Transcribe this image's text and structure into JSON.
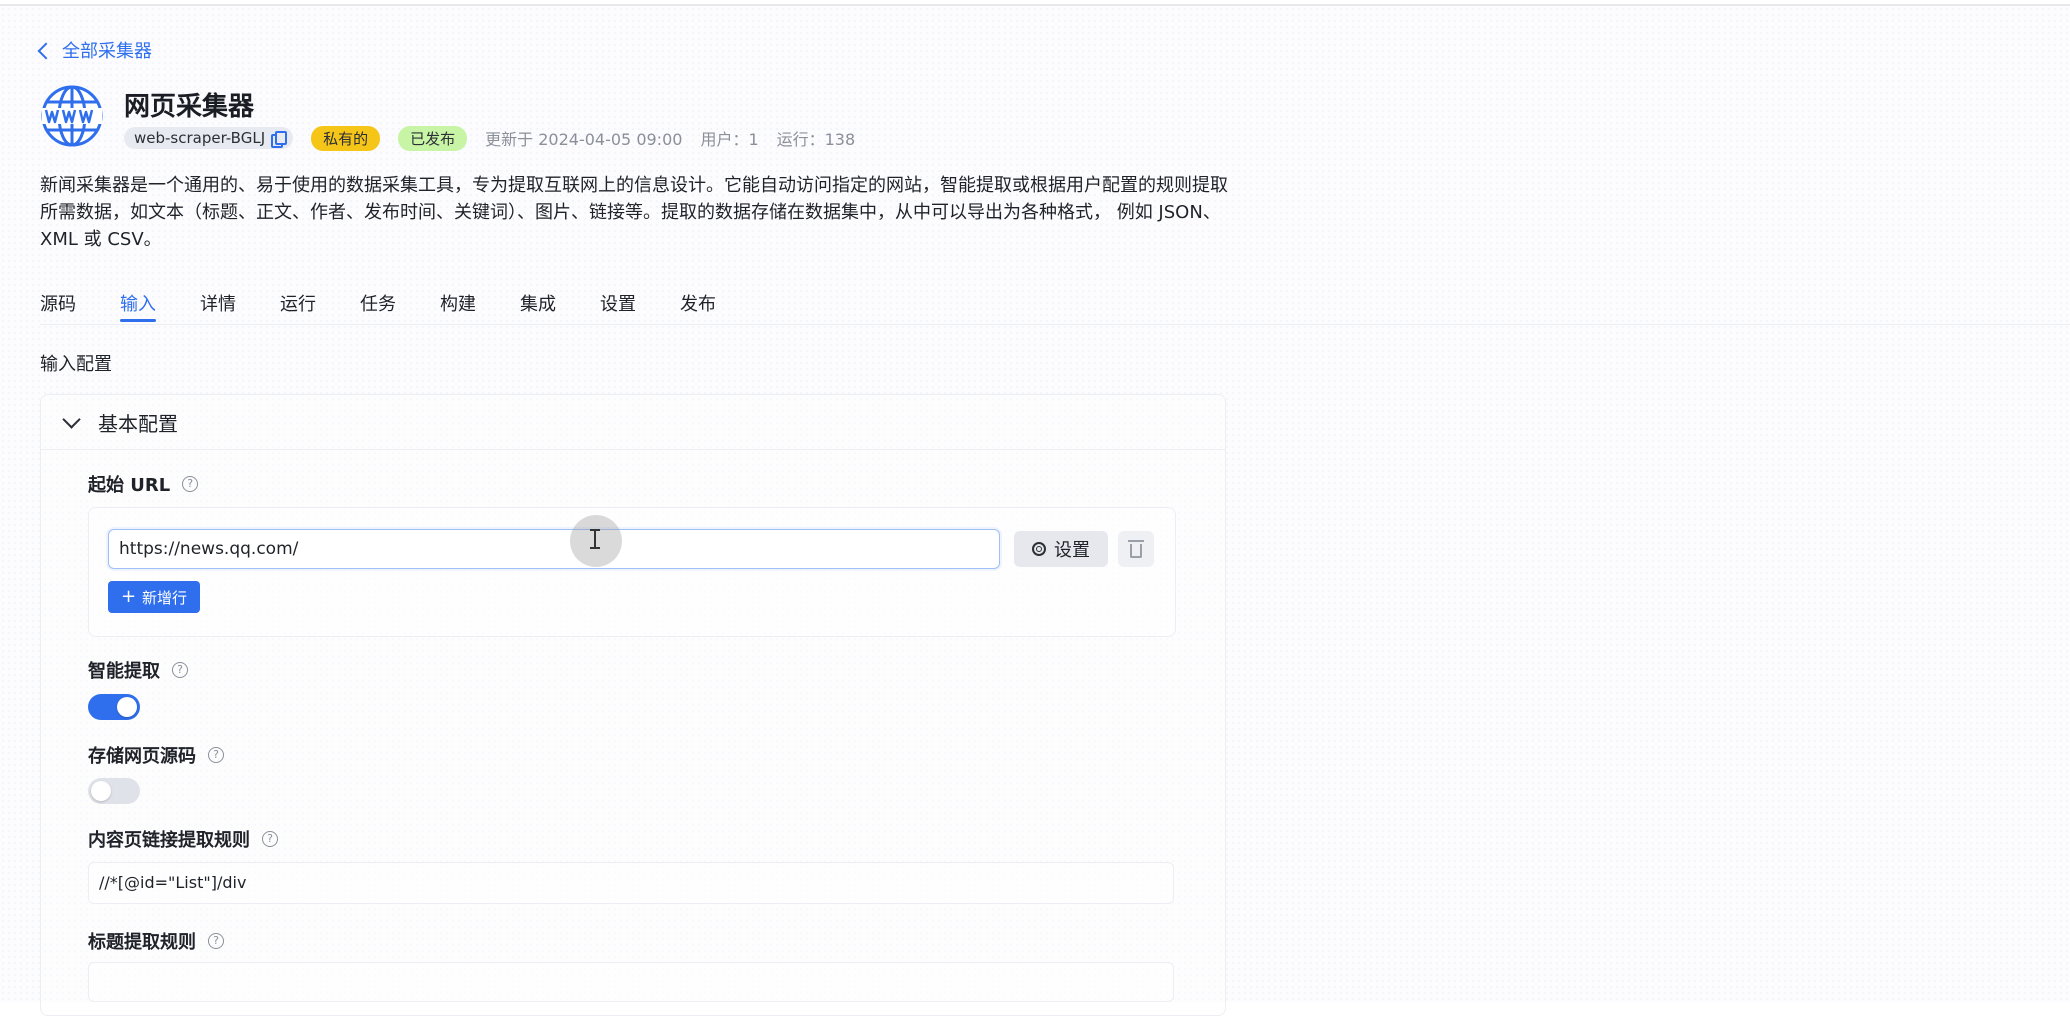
{
  "nav": {
    "back_label": "全部采集器"
  },
  "app": {
    "icon": "globe-www-icon",
    "title": "网页采集器",
    "slug": "web-scraper-BGLJ",
    "badge_private": "私有的",
    "badge_published": "已发布",
    "updated": "更新于 2024-04-05 09:00",
    "users": "用户：1",
    "runs": "运行：138",
    "description": "新闻采集器是一个通用的、易于使用的数据采集工具，专为提取互联网上的信息设计。它能自动访问指定的网站，智能提取或根据用户配置的规则提取所需数据，如文本（标题、正文、作者、发布时间、关键词）、图片、链接等。提取的数据存储在数据集中，从中可以导出为各种格式， 例如 JSON、XML 或 CSV。"
  },
  "tabs": [
    {
      "label": "源码",
      "active": false
    },
    {
      "label": "输入",
      "active": true
    },
    {
      "label": "详情",
      "active": false
    },
    {
      "label": "运行",
      "active": false
    },
    {
      "label": "任务",
      "active": false
    },
    {
      "label": "构建",
      "active": false
    },
    {
      "label": "集成",
      "active": false
    },
    {
      "label": "设置",
      "active": false
    },
    {
      "label": "发布",
      "active": false
    }
  ],
  "input_config": {
    "section_label": "输入配置",
    "panel_title": "基本配置",
    "start_url": {
      "label": "起始 URL",
      "value": "https://news.qq.com/",
      "settings_label": "设置",
      "add_row_label": "新增行"
    },
    "smart_extract": {
      "label": "智能提取",
      "enabled": true
    },
    "store_source": {
      "label": "存储网页源码",
      "enabled": false
    },
    "content_link_rule": {
      "label": "内容页链接提取规则",
      "value": "//*[@id=\"List\"]/div"
    },
    "title_rule": {
      "label": "标题提取规则",
      "value": ""
    }
  },
  "colors": {
    "accent": "#2f6fed",
    "badge_private": "#f5c518",
    "badge_published": "#c8f4a6"
  }
}
